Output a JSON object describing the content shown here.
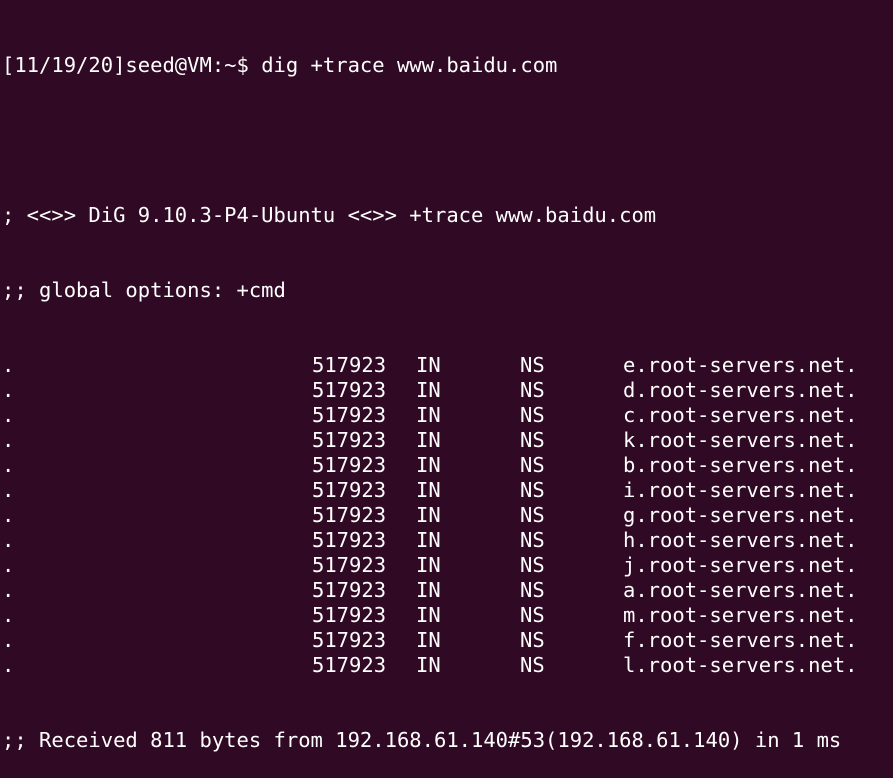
{
  "terminal": {
    "prompt": "[11/19/20]seed@VM:~$ ",
    "command": "dig +trace www.baidu.com",
    "header": "; <<>> DiG 9.10.3-P4-Ubuntu <<>> +trace www.baidu.com",
    "global_options": ";; global options: +cmd",
    "records": [
      {
        "name": ".",
        "ttl": "517923",
        "class": "IN",
        "type": "NS",
        "data": "e.root-servers.net."
      },
      {
        "name": ".",
        "ttl": "517923",
        "class": "IN",
        "type": "NS",
        "data": "d.root-servers.net."
      },
      {
        "name": ".",
        "ttl": "517923",
        "class": "IN",
        "type": "NS",
        "data": "c.root-servers.net."
      },
      {
        "name": ".",
        "ttl": "517923",
        "class": "IN",
        "type": "NS",
        "data": "k.root-servers.net."
      },
      {
        "name": ".",
        "ttl": "517923",
        "class": "IN",
        "type": "NS",
        "data": "b.root-servers.net."
      },
      {
        "name": ".",
        "ttl": "517923",
        "class": "IN",
        "type": "NS",
        "data": "i.root-servers.net."
      },
      {
        "name": ".",
        "ttl": "517923",
        "class": "IN",
        "type": "NS",
        "data": "g.root-servers.net."
      },
      {
        "name": ".",
        "ttl": "517923",
        "class": "IN",
        "type": "NS",
        "data": "h.root-servers.net."
      },
      {
        "name": ".",
        "ttl": "517923",
        "class": "IN",
        "type": "NS",
        "data": "j.root-servers.net."
      },
      {
        "name": ".",
        "ttl": "517923",
        "class": "IN",
        "type": "NS",
        "data": "a.root-servers.net."
      },
      {
        "name": ".",
        "ttl": "517923",
        "class": "IN",
        "type": "NS",
        "data": "m.root-servers.net."
      },
      {
        "name": ".",
        "ttl": "517923",
        "class": "IN",
        "type": "NS",
        "data": "f.root-servers.net."
      },
      {
        "name": ".",
        "ttl": "517923",
        "class": "IN",
        "type": "NS",
        "data": "l.root-servers.net."
      }
    ],
    "footer": ";; Received 811 bytes from 192.168.61.140#53(192.168.61.140) in 1 ms"
  },
  "colors": {
    "background": "#300a24",
    "foreground": "#ffffff"
  }
}
